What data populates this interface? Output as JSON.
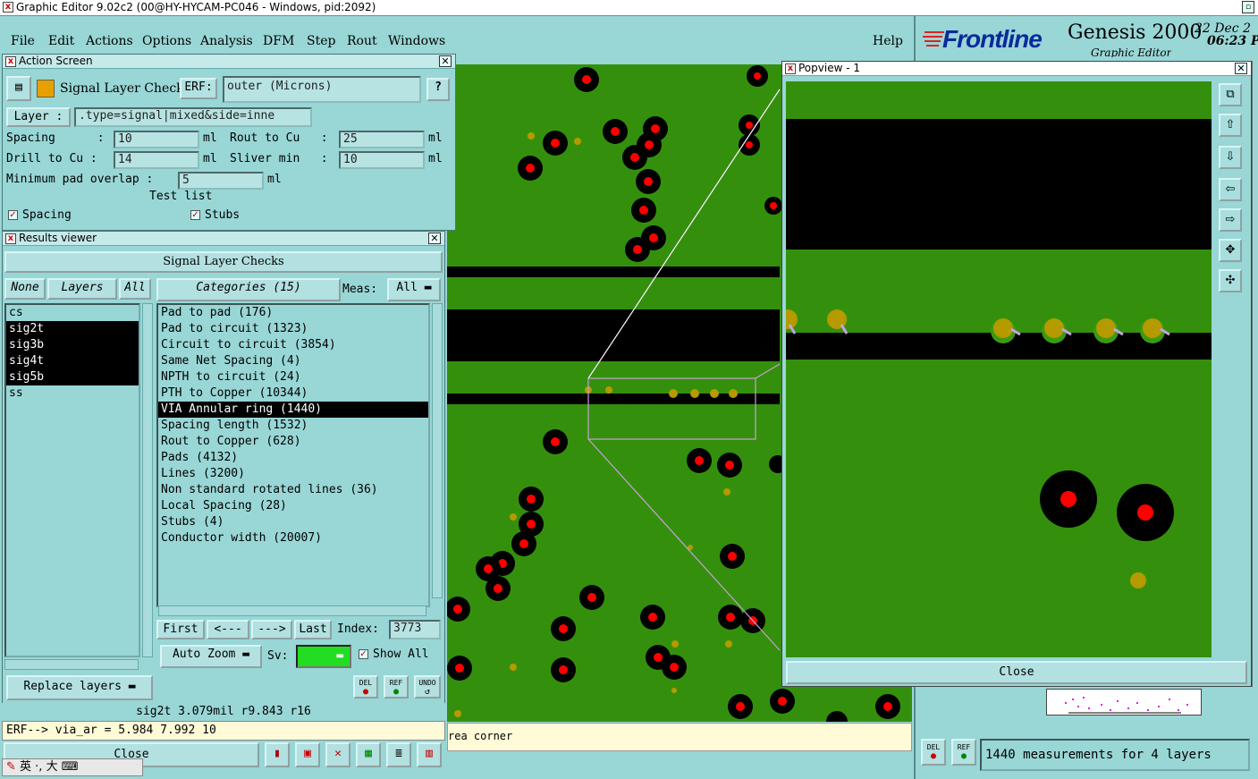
{
  "window": {
    "title": "Graphic Editor 9.02c2 (00@HY-HYCAM-PC046 - Windows, pid:2092)"
  },
  "menu": {
    "items": [
      "File",
      "Edit",
      "Actions",
      "Options",
      "Analysis",
      "DFM",
      "Step",
      "Rout",
      "Windows"
    ],
    "help": "Help"
  },
  "brand": {
    "logo": "Frontline",
    "product": "Genesis 2000",
    "subtitle": "Graphic Editor",
    "date": "22 Dec 2",
    "time": "06:23 P"
  },
  "action_screen": {
    "title": "Action Screen",
    "check_name": "Signal Layer Checks",
    "erf_label": "ERF:",
    "erf_value": "outer (Microns)",
    "help": "?",
    "layer_label": "Layer :",
    "layer_value": ".type=signal|mixed&side=inne",
    "spacing_label": "Spacing      :",
    "spacing_value": "10",
    "spacing_unit": "ml",
    "rout_label": "Rout to Cu   :",
    "rout_value": "25",
    "rout_unit": "ml",
    "drill_label": "Drill to Cu :",
    "drill_value": "14",
    "drill_unit": "ml",
    "sliver_label": "Sliver min   :",
    "sliver_value": "10",
    "sliver_unit": "ml",
    "overlap_label": "Minimum pad overlap :",
    "overlap_value": "5",
    "overlap_unit": "ml",
    "test_list_label": "Test list",
    "test_spacing": "Spacing",
    "test_stubs": "Stubs"
  },
  "results_viewer": {
    "title": "Results viewer",
    "header": "Signal Layer Checks",
    "none_btn": "None",
    "layers_btn": "Layers",
    "all_btn": "All",
    "layers": [
      {
        "name": "cs",
        "selected": false
      },
      {
        "name": "sig2t",
        "selected": true
      },
      {
        "name": "sig3b",
        "selected": true
      },
      {
        "name": "sig4t",
        "selected": true
      },
      {
        "name": "sig5b",
        "selected": true
      },
      {
        "name": "ss",
        "selected": false
      }
    ],
    "categories_btn": "Categories (15)",
    "meas_label": "Meas:",
    "meas_value": "All",
    "categories": [
      {
        "name": "Pad to pad (176)",
        "selected": false
      },
      {
        "name": "Pad to circuit (1323)",
        "selected": false
      },
      {
        "name": "Circuit to circuit (3854)",
        "selected": false
      },
      {
        "name": "Same Net Spacing (4)",
        "selected": false
      },
      {
        "name": "NPTH to circuit (24)",
        "selected": false
      },
      {
        "name": "PTH to Copper (10344)",
        "selected": false
      },
      {
        "name": "VIA Annular ring (1440)",
        "selected": true
      },
      {
        "name": "Spacing length (1532)",
        "selected": false
      },
      {
        "name": "Rout to Copper (628)",
        "selected": false
      },
      {
        "name": "Pads (4132)",
        "selected": false
      },
      {
        "name": "Lines (3200)",
        "selected": false
      },
      {
        "name": "Non standard rotated lines (36)",
        "selected": false
      },
      {
        "name": "Local Spacing (28)",
        "selected": false
      },
      {
        "name": "Stubs (4)",
        "selected": false
      },
      {
        "name": "Conductor width (20007)",
        "selected": false
      }
    ],
    "first_btn": "First",
    "prev_btn": "<---",
    "next_btn": "--->",
    "last_btn": "Last",
    "index_label": "Index:",
    "index_value": "3773",
    "auto_zoom": "Auto Zoom",
    "sv_label": "Sv:",
    "show_all": "Show All",
    "replace_layers": "Replace layers",
    "del_label": "DEL",
    "ref_label": "REF",
    "undo_label": "UNDO",
    "status_line": "sig2t 3.079mil  r9.843  r16",
    "erf_line": "ERF--> via_ar = 5.984 7.992 10",
    "close": "Close"
  },
  "popview": {
    "title": "Popview - 1",
    "close": "Close"
  },
  "bottom": {
    "area_text": "rea corner",
    "measurements": "1440 measurements for 4 layers",
    "del": "DEL",
    "ref": "REF"
  },
  "ime": {
    "chars": "英 ·, 大"
  },
  "colors": {
    "board": "#34900c",
    "pad_black": "#000000",
    "pad_red": "#ff0000",
    "via_gold": "#bfa000",
    "panel": "#99d6d6"
  }
}
